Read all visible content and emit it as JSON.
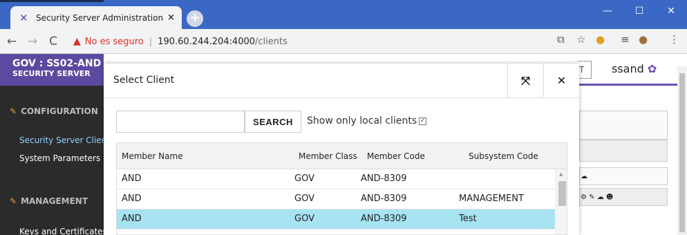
{
  "browser": {
    "tab_title": "Security Server Administration",
    "tab_close": "×",
    "new_tab": "+",
    "insecure_text": "No es seguro",
    "url_host": "190.60.244.204:4000",
    "url_path": "/clients"
  },
  "app": {
    "brand_line1": "GOV : SS02-AND",
    "brand_line2": "SECURITY SERVER",
    "user": "ssand",
    "header_button_fragment": "T",
    "sidebar": {
      "configuration": "CONFIGURATION",
      "items_config": [
        "Security Server Clients",
        "System Parameters"
      ],
      "management": "MANAGEMENT",
      "items_mgmt": [
        "Keys and Certificates"
      ]
    }
  },
  "modal": {
    "title": "Select Client",
    "search_placeholder": "",
    "search_button": "SEARCH",
    "local_clients_label": "Show only local clients",
    "local_clients_checked": true,
    "columns": [
      "Member Name",
      "Member Class",
      "Member Code",
      "Subsystem Code"
    ],
    "rows": [
      {
        "member_name": "AND",
        "member_class": "GOV",
        "member_code": "AND-8309",
        "subsystem_code": ""
      },
      {
        "member_name": "AND",
        "member_class": "GOV",
        "member_code": "AND-8309",
        "subsystem_code": "MANAGEMENT"
      },
      {
        "member_name": "AND",
        "member_class": "GOV",
        "member_code": "AND-8309",
        "subsystem_code": "Test"
      }
    ],
    "selected_row": 2
  },
  "colors": {
    "chrome_titlebar": "#3a68c4",
    "brand": "#5b4aa0",
    "selected_row": "#a7e3f0",
    "insecure": "#d93025"
  }
}
